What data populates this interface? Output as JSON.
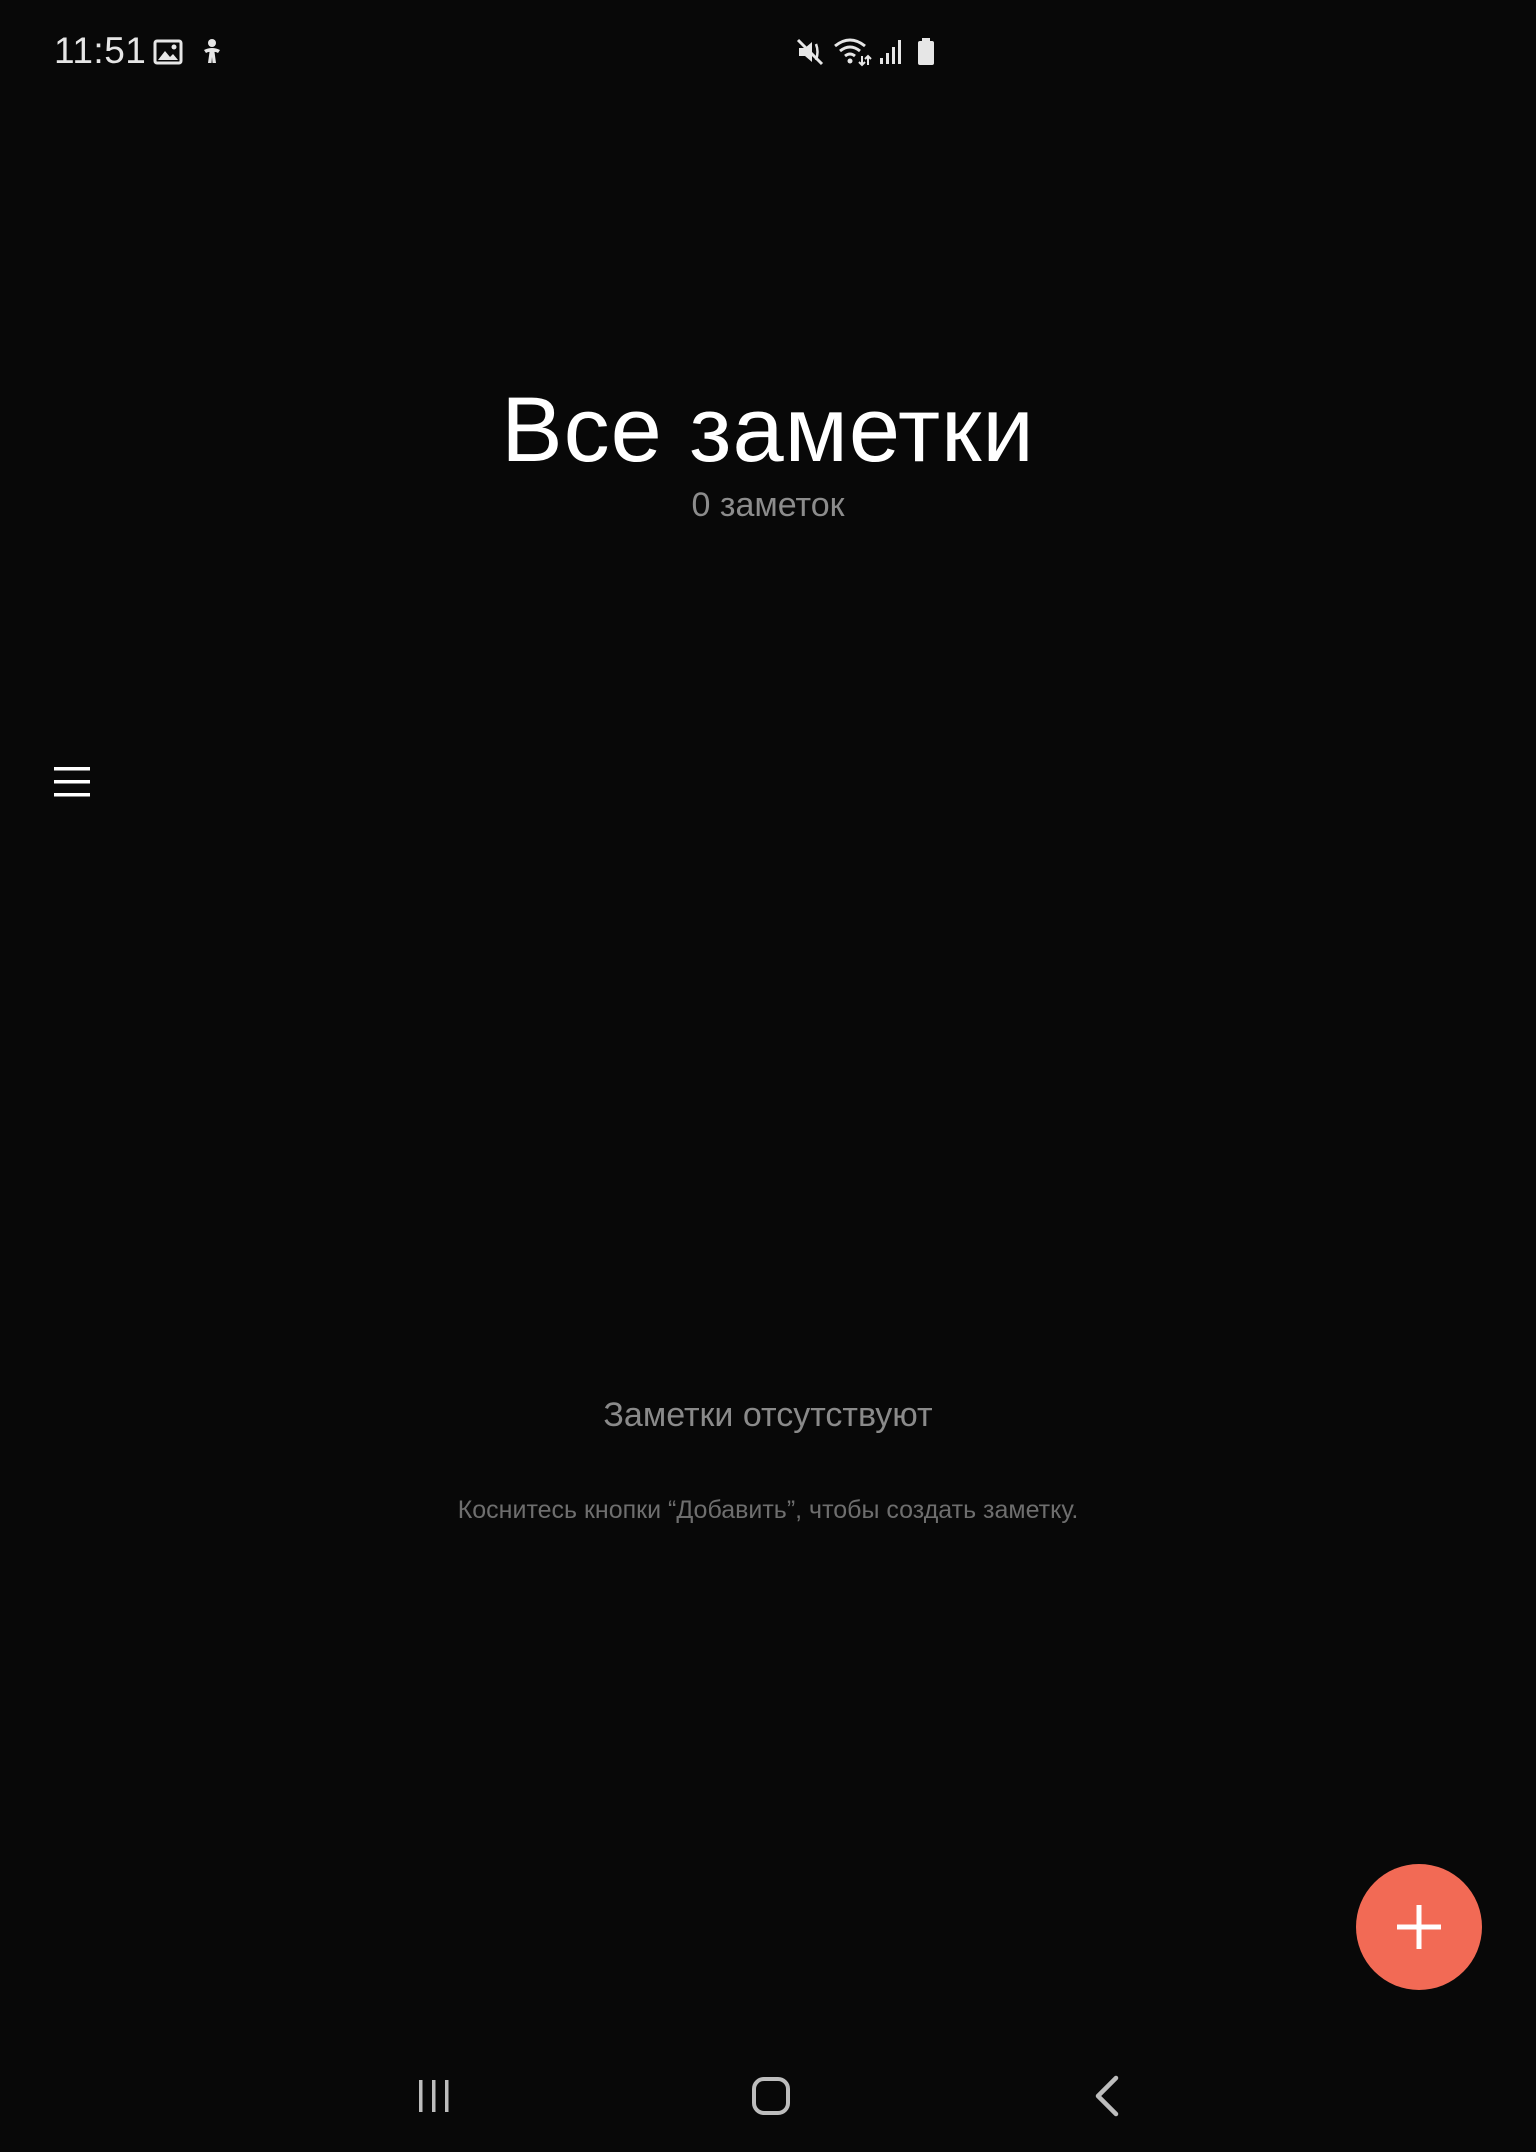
{
  "status_bar": {
    "time": "11:51",
    "left_icons": [
      "gallery-icon",
      "accessibility-icon"
    ],
    "right_icons": [
      "mute-icon",
      "wifi-icon",
      "signal-icon",
      "battery-icon"
    ]
  },
  "header": {
    "title": "Все заметки",
    "count": "0 заметок"
  },
  "menu": {
    "icon": "hamburger-menu-icon"
  },
  "empty_state": {
    "title": "Заметки отсутствуют",
    "hint": "Коснитесь кнопки “Добавить”, чтобы создать заметку."
  },
  "fab": {
    "icon": "plus-icon",
    "color": "#f26a55"
  },
  "nav_bar": {
    "buttons": [
      "recent-apps-icon",
      "home-icon",
      "back-icon"
    ]
  },
  "colors": {
    "background": "#080808",
    "title": "#ffffff",
    "secondary_text": "#8c8c8c",
    "accent": "#f26a55"
  }
}
